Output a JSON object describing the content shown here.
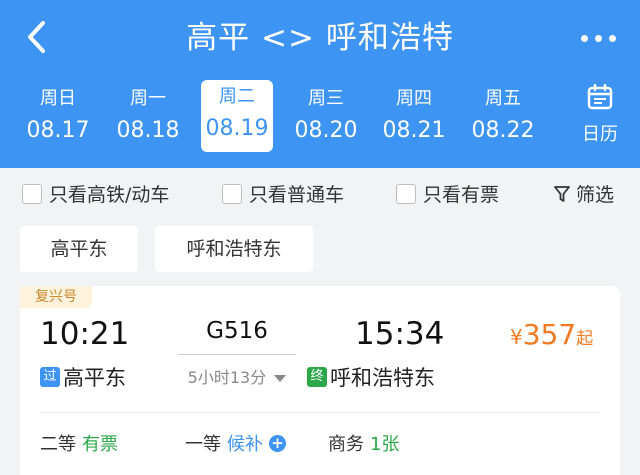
{
  "header": {
    "title": "高平 <> 呼和浩特",
    "calendar_label": "日历"
  },
  "date_tabs": [
    {
      "weekday": "周日",
      "date": "08.17"
    },
    {
      "weekday": "周一",
      "date": "08.18"
    },
    {
      "weekday": "周二",
      "date": "08.19",
      "selected": true
    },
    {
      "weekday": "周三",
      "date": "08.20"
    },
    {
      "weekday": "周四",
      "date": "08.21"
    },
    {
      "weekday": "周五",
      "date": "08.22"
    }
  ],
  "filters": {
    "high_speed": "只看高铁/动车",
    "regular": "只看普通车",
    "available": "只看有票",
    "filter_label": "筛选"
  },
  "stations": {
    "from": "高平东",
    "to": "呼和浩特东"
  },
  "train": {
    "badge": "复兴号",
    "depart_time": "10:21",
    "arrive_time": "15:34",
    "number": "G516",
    "duration": "5小时13分",
    "price_currency": "¥",
    "price": "357",
    "price_suffix": "起",
    "from_tag": "过",
    "from_station": "高平东",
    "to_tag": "终",
    "to_station": "呼和浩特东",
    "seats": [
      {
        "class": "二等",
        "status": "有票"
      },
      {
        "class": "一等",
        "status": "候补"
      },
      {
        "class": "商务",
        "status": "1张"
      }
    ]
  },
  "colors": {
    "primary": "#3d94f3",
    "available": "#2ca84a",
    "price": "#f27b22",
    "badge_bg": "#fdf3dc",
    "badge_text": "#c9882a",
    "via_tag": "#3d94f3",
    "end_tag": "#2ca84a"
  }
}
